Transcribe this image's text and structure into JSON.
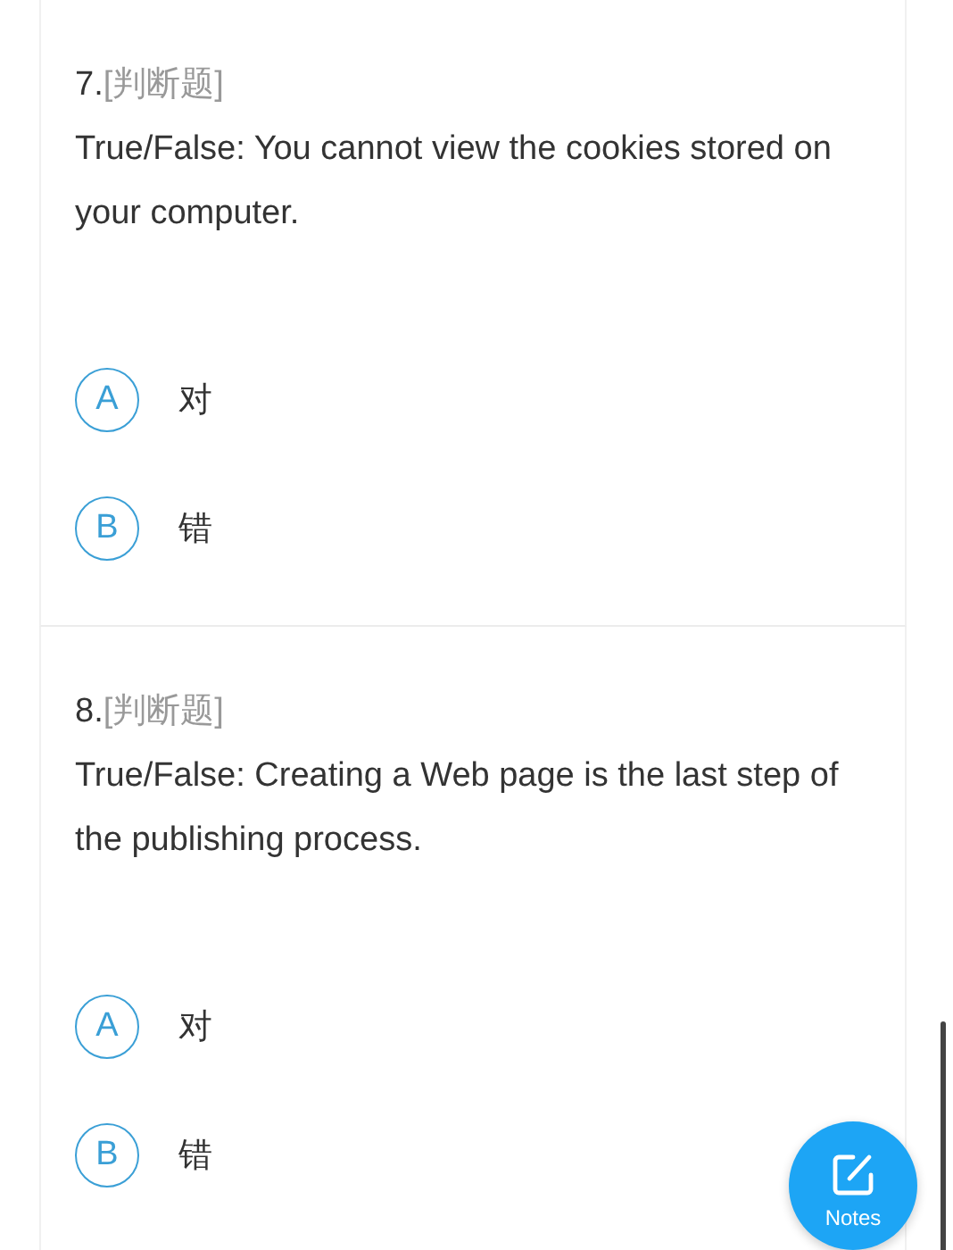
{
  "questions": [
    {
      "number": "7.",
      "type": "[判断题]",
      "text": "True/False: You cannot view the cookies stored on your computer.",
      "options": [
        {
          "letter": "A",
          "label": "对"
        },
        {
          "letter": "B",
          "label": "错"
        }
      ]
    },
    {
      "number": "8.",
      "type": "[判断题]",
      "text": "True/False: Creating a Web page is the last step of the publishing process.",
      "options": [
        {
          "letter": "A",
          "label": "对"
        },
        {
          "letter": "B",
          "label": "错"
        }
      ]
    }
  ],
  "notes_button": {
    "label": "Notes"
  }
}
